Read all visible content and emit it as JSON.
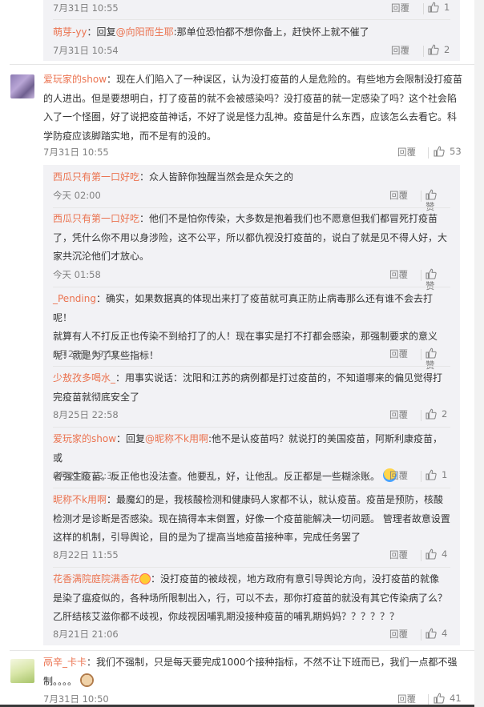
{
  "labels": {
    "reply": "回覆"
  },
  "top_partial": {
    "time": "7月31日 10:55",
    "likes": "1"
  },
  "c_mengya": {
    "user": "萌芽-yy",
    "prefix": "：回复",
    "at": "@向阳而生耶",
    "text": ":那单位恐怕都不想你备上，赶快怀上就不催了",
    "time": "7月31日 10:54",
    "likes": "2"
  },
  "c_main1": {
    "user": "爱玩家的show",
    "lines": [
      "：现在人们陷入了一种误区，认为没打疫苗的人是危险的。有些地方会限制没打疫苗",
      "的人进出。但是要想明白，打了疫苗的就不会被感染吗？没打疫苗的就一定感染了吗？这个社会陷",
      "入了一个怪圈，好了说把疫苗神话，不好了说是怪力乱神。疫苗是什么东西，应该怎么去看它。科",
      "学防疫应该脚踏实地，而不是有的没的。"
    ],
    "time": "7月31日 10:55",
    "likes": "53"
  },
  "replies": [
    {
      "user": "西瓜只有第一口好吃",
      "lines": [
        "：众人皆醉你独醒当然会是众矢之的"
      ],
      "time": "今天 02:00",
      "likes": "赞"
    },
    {
      "user": "西瓜只有第一口好吃",
      "lines": [
        "：他们不是怕你传染，大多数是抱着我们也不愿意但我们都冒死打疫苗",
        "了，凭什么你不用以身涉险，这不公平，所以都仇视没打疫苗的，说白了就是见不得人好，大",
        "家共沉沦他们才放心。"
      ],
      "time": "今天 01:58",
      "likes": "赞"
    },
    {
      "user": "_Pending",
      "lines": [
        "：确实，如果数据真的体现出来打了疫苗就可真正防止病毒那么还有谁不会去打呢！",
        "就算有人不打反正也传染不到给打了的人！现在事实是打不打都会感染，那强制要求的意义",
        "呢！就是为了某些指标！"
      ],
      "time": "8月27日 09:18",
      "likes": "赞"
    },
    {
      "user": "少敖孜多喝水_",
      "lines": [
        "：用事实说话：沈阳和江苏的病例都是打过疫苗的，不知道哪来的偏见觉得打",
        "完疫苗就彻底安全了"
      ],
      "time": "8月25日 22:58",
      "likes": "2"
    },
    {
      "user": "爱玩家的show",
      "prefix": "：回复",
      "at": "@昵称不k用啊",
      "lines": [
        ":他不是认疫苗吗？就说打的美国疫苗，阿斯利康疫苗，或",
        "者强生疫苗。反正他也没法查。他要乱，好，让他乱。反正都是一些糊涂账。"
      ],
      "time": "8月22日 12:35",
      "likes": "1"
    },
    {
      "user": "昵称不k用啊",
      "lines": [
        "：最魔幻的是，我核酸检测和健康码人家都不认，就认疫苗。疫苗是预防，核酸",
        "检测才是诊断是否感染。现在搞得本末倒置，好像一个疫苗能解决一切问题。 管理者故意设置",
        "这样的机制，引导舆论，目的是为了提高当地疫苗接种率，完成任务罢了"
      ],
      "time": "8月22日 11:55",
      "likes": "4"
    },
    {
      "user": "花香满院庭院满香花",
      "lines": [
        "：没打疫苗的被歧视，地方政府有意引导舆论方向，没打疫苗的就像",
        "是染了瘟疫似的，各种场所限制出入，行，可以不去，那你打疫苗的就没有其它传染病了么？",
        "乙肝结核艾滋你都不歧视，你歧视因哺乳期没接种疫苗的哺乳期妈妈？？？？？？"
      ],
      "time": "8月21日 21:06",
      "likes": "4"
    }
  ],
  "c_main2": {
    "user": "鬲辛_卡卡",
    "lines": [
      "：我们不强制，只是每天要完成1000个接种指标，不然不让下班而已，我们一点都不强",
      "制。。。。"
    ],
    "time": "7月31日 10:50",
    "likes": "41"
  },
  "colors": {
    "username": "#eb7350",
    "meta": "#808080",
    "thread_bg": "#f2f2f5"
  }
}
